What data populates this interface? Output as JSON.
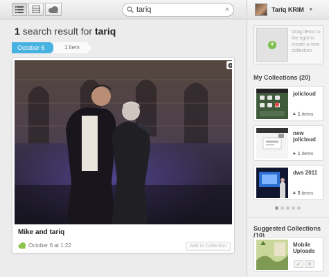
{
  "toolbar": {
    "view_buttons": [
      "list-view-icon",
      "grid-view-icon",
      "cloud-view-icon"
    ]
  },
  "search": {
    "value": "tariq",
    "clear_label": "×"
  },
  "results": {
    "count": "1",
    "text": "search result for",
    "query": "tariq"
  },
  "timeline": {
    "date": "October 6",
    "count_label": "1 item"
  },
  "card": {
    "title": "Mike and tariq",
    "date": "October 6 at 1:22",
    "add_button": "Add to Collection"
  },
  "user": {
    "name": "Tariq KRIM"
  },
  "dropzone": {
    "text": "Drag items to the right to create a new collection."
  },
  "collections": {
    "title": "My Collections (20)",
    "items": [
      {
        "name": "jolicloud",
        "count": "1",
        "unit": "items"
      },
      {
        "name": "new jolicloud",
        "count": "1",
        "unit": "items"
      },
      {
        "name": "dws 2011",
        "count": "5",
        "unit": "items"
      }
    ],
    "pages": 5,
    "active_page": 1
  },
  "suggested": {
    "title": "Suggested Collections (10)",
    "items": [
      {
        "name": "Mobile Uploads",
        "accept": "✓",
        "reject": "✕"
      }
    ]
  },
  "colors": {
    "accent": "#47b2e0",
    "green": "#7cc04a"
  }
}
